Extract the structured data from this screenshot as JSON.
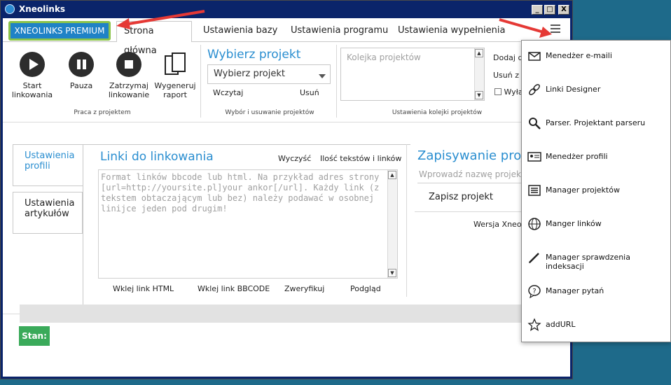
{
  "window": {
    "title": "Xneolinks",
    "min_label": "_",
    "max_label": "□",
    "close_label": "X"
  },
  "header": {
    "premium_badge": "XNEOLINKS PREMIUM",
    "tabs": [
      {
        "label": "Strona główna"
      },
      {
        "label": "Ustawienia bazy"
      },
      {
        "label": "Ustawienia programu"
      },
      {
        "label": "Ustawienia wypełnienia"
      }
    ]
  },
  "ribbon": {
    "linking_group": {
      "label": "Praca z projektem",
      "buttons": [
        {
          "label": "Start\nlinkowania",
          "icon": "play-icon"
        },
        {
          "label": "Pauza",
          "icon": "pause-icon"
        },
        {
          "label": "Zatrzymaj\nlinkowanie",
          "icon": "stop-icon"
        },
        {
          "label": "Wygeneruj\nraport",
          "icon": "report-icon"
        }
      ]
    },
    "project_group": {
      "heading": "Wybierz projekt",
      "select_value": "Wybierz projekt",
      "load_label": "Wczytaj",
      "delete_label": "Usuń",
      "label": "Wybór i usuwanie projektów"
    },
    "queue_group": {
      "placeholder": "Kolejka projektów",
      "add_label": "Dodaj d",
      "remove_label": "Usuń z k",
      "checkbox_label": "Wyłą",
      "label": "Ustawienia kolejki projektów"
    }
  },
  "side_tabs": [
    {
      "label": "Ustawienia\nprofili"
    },
    {
      "label": "Ustawienia\nartykułów"
    }
  ],
  "links_panel": {
    "heading": "Linki do linkowania",
    "clear_label": "Wyczyść",
    "count_label": "Ilość tekstów i linków",
    "placeholder": "Format linków bbcode lub html. Na przykład adres strony [url=http://yoursite.pl]your ankor[/url]. Każdy link (z tekstem obtaczającym lub bez) należy podawać w osobnej linijce jeden pod drugim!",
    "actions": [
      "Wklej link HTML",
      "Wklej link BBCODE",
      "Zweryfikuj",
      "Podgląd"
    ]
  },
  "save_panel": {
    "heading": "Zapisywanie proj",
    "input_placeholder": "Wprowadź nazwę projek",
    "save_button": "Zapisz projekt",
    "version_text": "Wersja Xneoli"
  },
  "status": {
    "label": "Stan:",
    "progress": 0
  },
  "menu": {
    "items": [
      {
        "label": "Menedżer e-maili",
        "icon": "email-icon"
      },
      {
        "label": "Linki Designer",
        "icon": "link-icon"
      },
      {
        "label": "Parser. Projektant parseru",
        "icon": "search-icon"
      },
      {
        "label": "Menedżer profili",
        "icon": "profile-card-icon"
      },
      {
        "label": "Manager projektów",
        "icon": "list-icon"
      },
      {
        "label": "Manger linków",
        "icon": "globe-icon"
      },
      {
        "label": "Manager sprawdzenia indeksacji",
        "icon": "pen-icon"
      },
      {
        "label": "Manager pytań",
        "icon": "question-icon"
      },
      {
        "label": "addURL",
        "icon": "star-icon"
      }
    ]
  },
  "colors": {
    "accent": "#2a8ed0",
    "premium_border": "#8bc34a",
    "status_green": "#3aaa5a",
    "arrow_red": "#e53935"
  }
}
